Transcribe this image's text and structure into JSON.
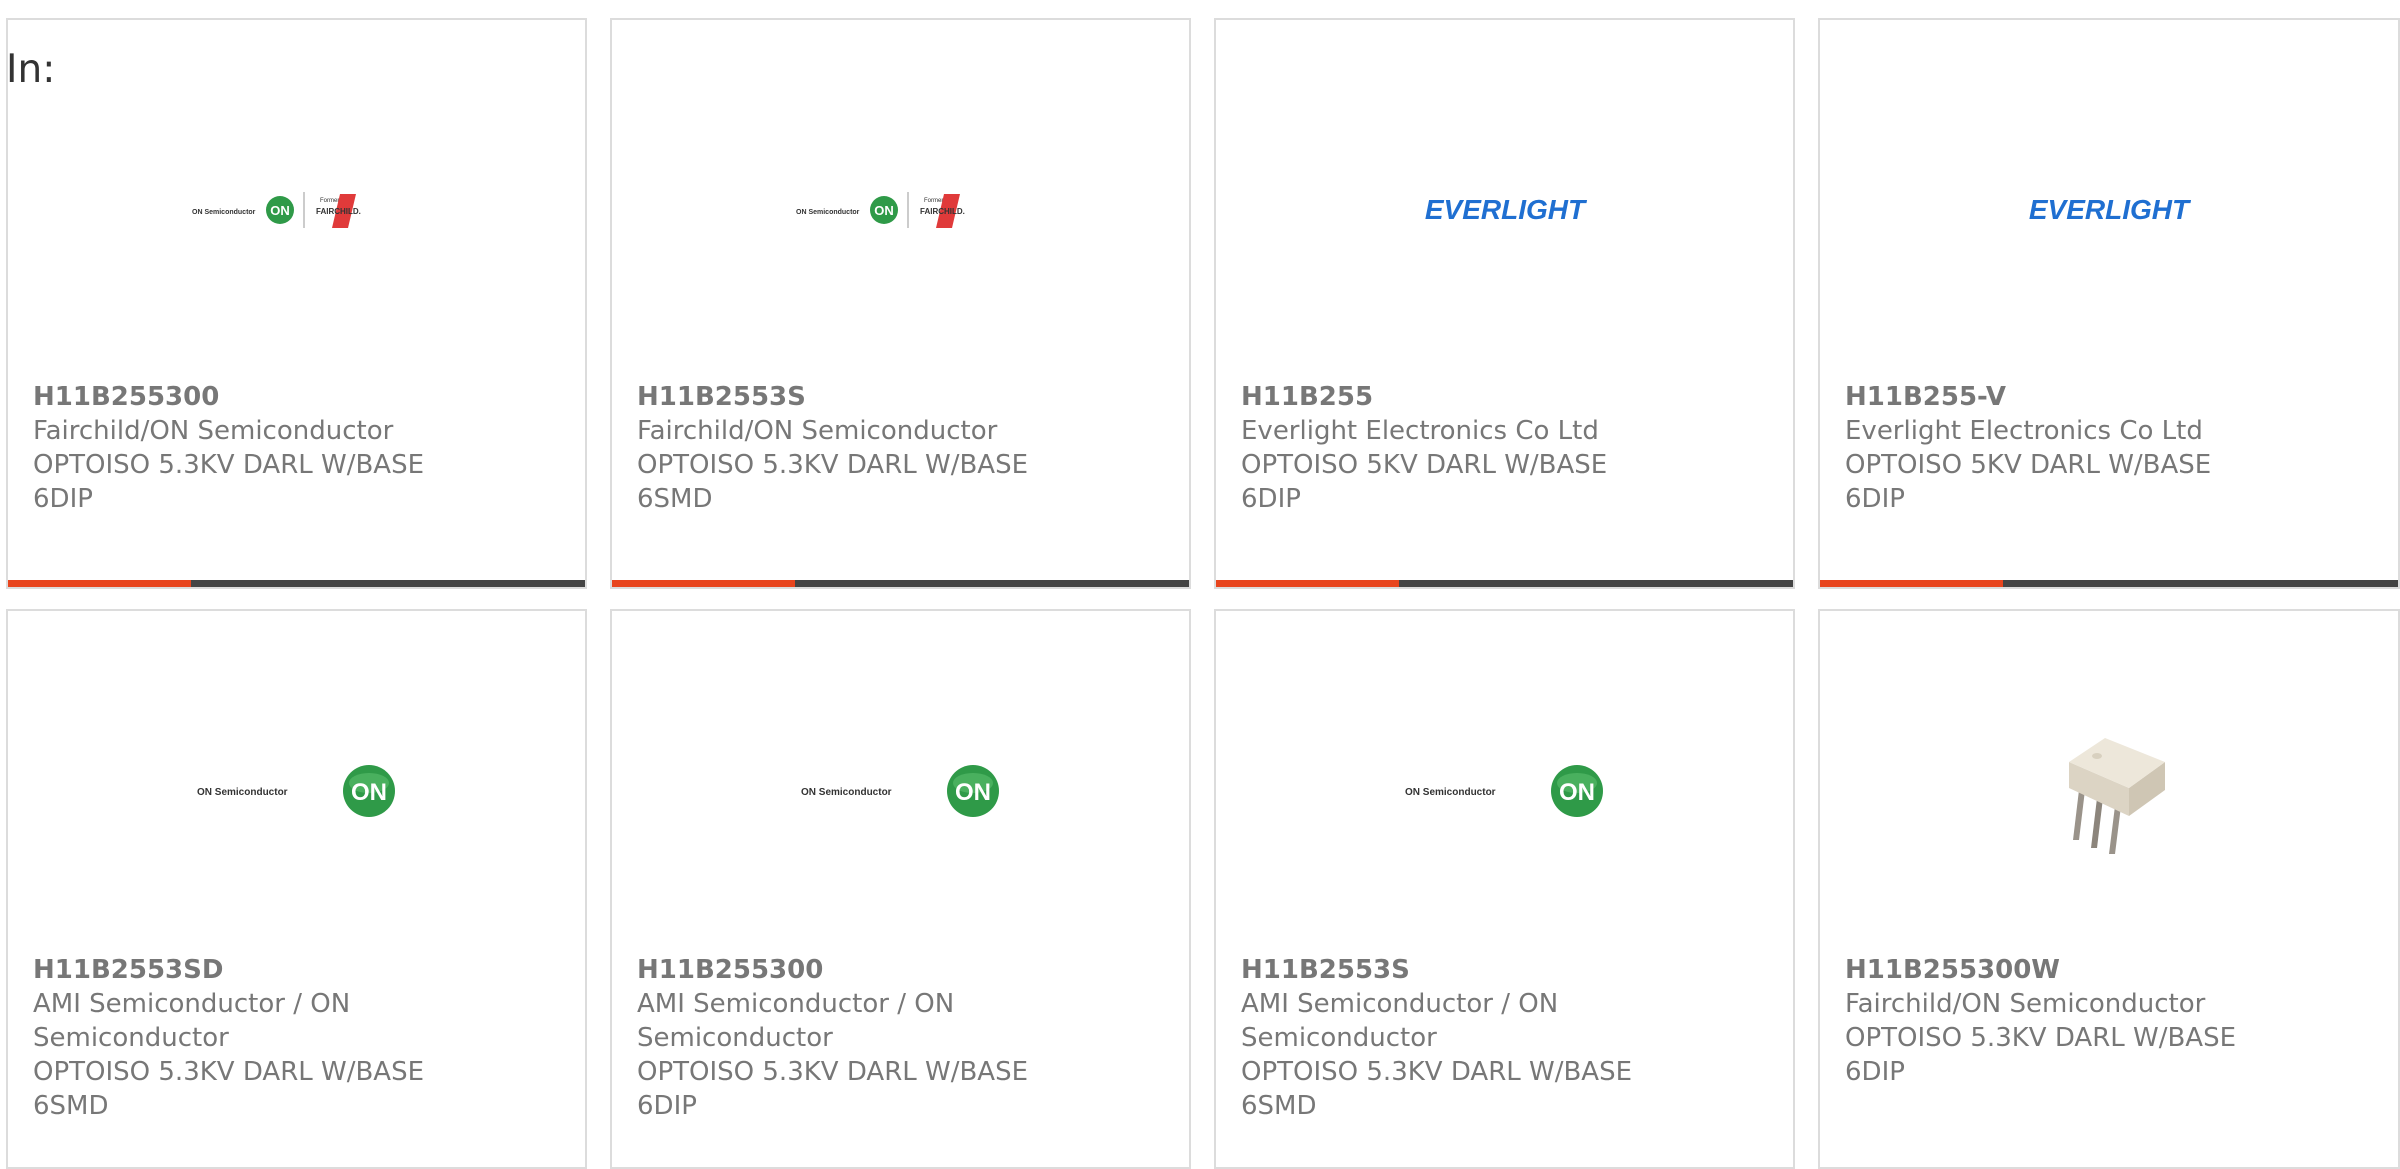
{
  "filter": {
    "label": "In:"
  },
  "products": [
    {
      "part": "H11B255300",
      "manufacturer": "Fairchild/ON Semiconductor",
      "description": "OPTOISO 5.3KV DARL W/BASE",
      "package": "6DIP",
      "logo": "fairchild-on-logo",
      "logo_text": {
        "on": "ON Semiconductor",
        "formerly": "Formerly",
        "brand": "FAIRCHILD."
      }
    },
    {
      "part": "H11B2553S",
      "manufacturer": "Fairchild/ON Semiconductor",
      "description": "OPTOISO 5.3KV DARL W/BASE",
      "package": "6SMD",
      "logo": "fairchild-on-logo",
      "logo_text": {
        "on": "ON Semiconductor",
        "formerly": "Formerly",
        "brand": "FAIRCHILD."
      }
    },
    {
      "part": "H11B255",
      "manufacturer": "Everlight Electronics Co Ltd",
      "description": "OPTOISO 5KV DARL W/BASE",
      "package": "6DIP",
      "logo": "everlight-logo",
      "logo_text": {
        "brand": "EVERLIGHT"
      }
    },
    {
      "part": "H11B255-V",
      "manufacturer": "Everlight Electronics Co Ltd",
      "description": "OPTOISO 5KV DARL W/BASE",
      "package": "6DIP",
      "logo": "everlight-logo",
      "logo_text": {
        "brand": "EVERLIGHT"
      }
    },
    {
      "part": "H11B2553SD",
      "manufacturer": "AMI Semiconductor / ON Semiconductor",
      "description": "OPTOISO 5.3KV DARL W/BASE",
      "package": "6SMD",
      "logo": "on-semiconductor-logo",
      "logo_text": {
        "on": "ON Semiconductor"
      }
    },
    {
      "part": "H11B255300",
      "manufacturer": "AMI Semiconductor / ON Semiconductor",
      "description": "OPTOISO 5.3KV DARL W/BASE",
      "package": "6DIP",
      "logo": "on-semiconductor-logo",
      "logo_text": {
        "on": "ON Semiconductor"
      }
    },
    {
      "part": "H11B2553S",
      "manufacturer": "AMI Semiconductor / ON Semiconductor",
      "description": "OPTOISO 5.3KV DARL W/BASE",
      "package": "6SMD",
      "logo": "on-semiconductor-logo",
      "logo_text": {
        "on": "ON Semiconductor"
      }
    },
    {
      "part": "H11B255300W",
      "manufacturer": "Fairchild/ON Semiconductor",
      "description": "OPTOISO 5.3KV DARL W/BASE",
      "package": "6DIP",
      "logo": "dip6-package-image"
    }
  ],
  "colors": {
    "accent": "#e8451e",
    "bar": "#444444",
    "border": "#dcdcdc",
    "text": "#777777",
    "everlight": "#1f6fd1",
    "on_green": "#2f9a48",
    "fairchild_red": "#e03a3a"
  }
}
